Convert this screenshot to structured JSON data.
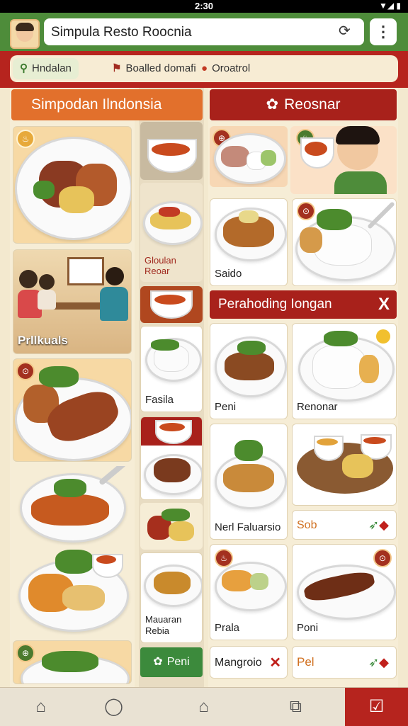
{
  "status": {
    "time": "2:30",
    "icons": "▼◢ ▮"
  },
  "appbar": {
    "title": "Simpula Resto Roocnia",
    "avatar": "avatar",
    "reload_icon": "reload-icon",
    "menu_icon": "more-vert-icon"
  },
  "tabs": [
    {
      "label": "Hndalan",
      "icon": "search-icon",
      "active": true
    },
    {
      "label": "Boalled domafi",
      "icon": "flag-icon",
      "active": false
    },
    {
      "label": "Oroatrol",
      "icon": "pin-icon",
      "active": false
    }
  ],
  "headers": {
    "left": "Simpodan Ilndonsia",
    "right": "Reosnar"
  },
  "left_cards": [
    {
      "label": ""
    },
    {
      "label": "Prllkuals"
    },
    {
      "label": ""
    },
    {
      "label": ""
    },
    {
      "label": ""
    },
    {
      "label": ""
    }
  ],
  "mid_cards": [
    {
      "label": ""
    },
    {
      "label": "Gloulan Reoar"
    },
    {
      "label": ""
    },
    {
      "label": "Fasila"
    },
    {
      "label": ""
    },
    {
      "label": ""
    },
    {
      "label": "Mauaran Rebia"
    }
  ],
  "mid_button": {
    "label": "Peni"
  },
  "right_cards": [
    {
      "label": ""
    },
    {
      "label": ""
    },
    {
      "label": "Saido"
    },
    {
      "label": ""
    },
    {
      "label": "Peni"
    },
    {
      "label": "Renonar"
    },
    {
      "label": "Nerl Faluarsio"
    },
    {
      "label": ""
    },
    {
      "label": "Sob"
    },
    {
      "label": "Prala"
    },
    {
      "label": "Poni"
    },
    {
      "label": "Mangroio"
    },
    {
      "label": "Pel"
    }
  ],
  "section_bar": {
    "label": "Perahoding Iongan",
    "x": "X"
  },
  "badges": {
    "b1": "♨",
    "b2": "⊙",
    "b3": "⊕",
    "b4": "⊕",
    "b5": "♨",
    "b6": "⊙"
  },
  "colors": {
    "brand_green": "#4e8c3a",
    "brand_red": "#b6241e",
    "orange": "#e2702c"
  },
  "bottom_nav": [
    {
      "icon": "home-icon"
    },
    {
      "icon": "chat-icon"
    },
    {
      "icon": "house-outline-icon"
    },
    {
      "icon": "share-icon"
    },
    {
      "icon": "checkbox-icon",
      "active": true
    }
  ]
}
